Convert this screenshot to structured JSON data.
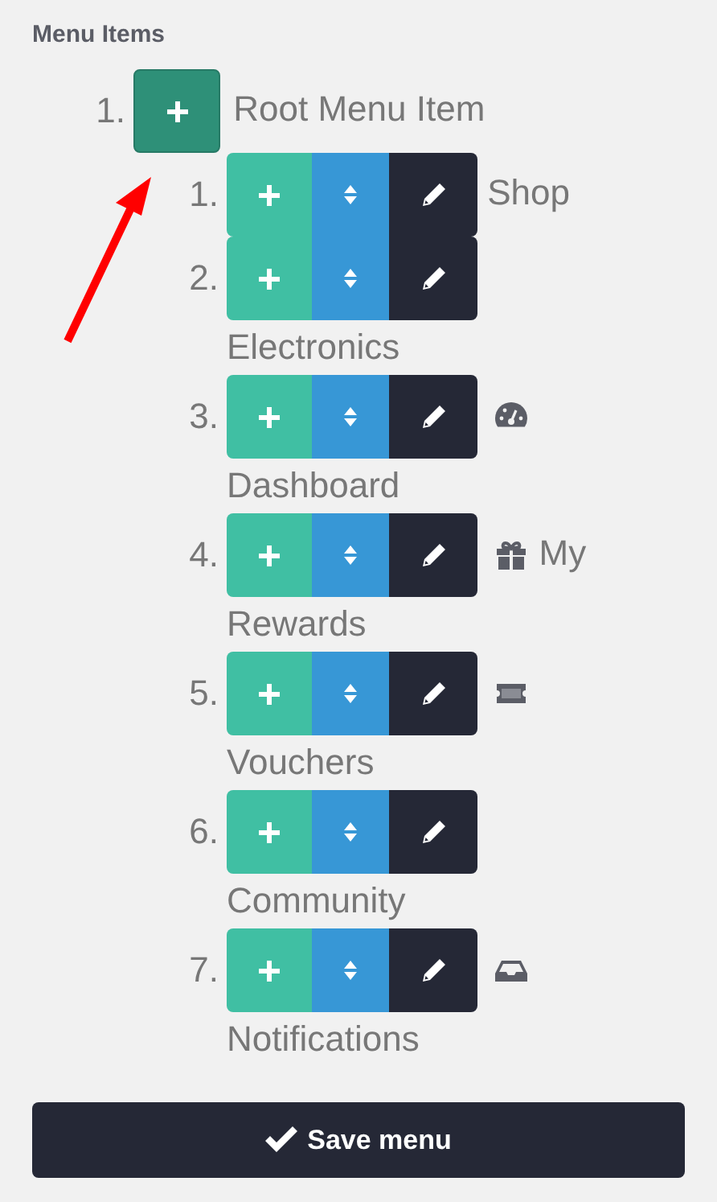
{
  "heading": "Menu Items",
  "root": {
    "number": "1.",
    "label": "Root Menu Item"
  },
  "annotation": {
    "kind": "arrow"
  },
  "items": [
    {
      "number": "1.",
      "label": "Shop"
    },
    {
      "number": "2.",
      "label": "Electronics"
    },
    {
      "number": "3.",
      "label": "Dashboard"
    },
    {
      "number": "4.",
      "label": "My Rewards"
    },
    {
      "number": "5.",
      "label": "Vouchers"
    },
    {
      "number": "6.",
      "label": "Community"
    },
    {
      "number": "7.",
      "label": "Notifications"
    }
  ],
  "save_button": {
    "label": "Save menu"
  }
}
